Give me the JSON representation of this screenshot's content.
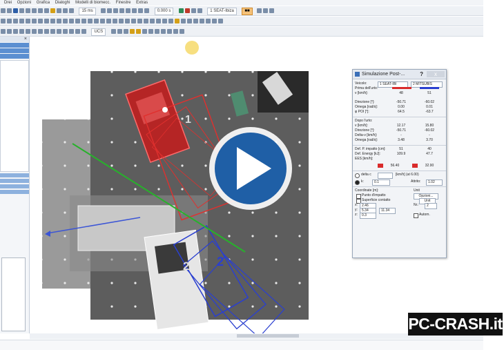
{
  "menubar": {
    "items": [
      "Drei",
      "Opzioni",
      "Grafica",
      "Dialoghi",
      "Modelli di biomecc.",
      "Finestre",
      "Extras"
    ]
  },
  "toolbar": {
    "zoom_select": "15 ms",
    "time_value": "0.000 s",
    "seat_select": "1  SEAT-Ibiza",
    "snap_select": "UCS"
  },
  "dialog": {
    "title": "Simulazione Post-...",
    "help_label": "?",
    "close_label": "x",
    "vehicle_label": "Veicolo:",
    "vehicle1": "1  SEAT-IBI",
    "vehicle2": "2  MITSUBIS",
    "before_label": "Prima dell'urto:",
    "v_label": "v [km/h]:",
    "v_before": [
      "48",
      "51"
    ],
    "direction_label": "Direzione [°]:",
    "direction_before": [
      "-50.71",
      "-60.02"
    ],
    "omega_label": "Omega [rad/s]:",
    "omega_before": [
      "0.00",
      "0.01"
    ],
    "phi_label": "φ POI [°]:",
    "phi_before": [
      "64.5",
      "-63.7"
    ],
    "after_label": "Dopo l'urto:",
    "v_after": [
      "12.17",
      "15.80"
    ],
    "direction_after": [
      "-50.71",
      "-60.02"
    ],
    "deltav_label": "Delta-v [km/h]:",
    "deltav": [
      "-",
      "-"
    ],
    "omega_after": [
      "3.48",
      "3.70"
    ],
    "defl_label": "Def. P. impatto [cm]:",
    "defl": [
      "51",
      "40"
    ],
    "energy_label": "Def. Energy [kJ]:",
    "energy": [
      "109.9",
      "47.7"
    ],
    "ees_label": "EES [km/h]:",
    "ees": [
      "56.40",
      "32.90"
    ],
    "delta_c_label": "delta c",
    "kmh_note": "[km/h] (at 6.00)",
    "k_label": "k:",
    "k_value": "0.1",
    "friction_label": "Attrito:",
    "friction_value": "1.02",
    "coords_label": "Coordinate [m]:",
    "impact_point_label": "Punto d'impatto",
    "contact_surface_label": "Superficie contatto",
    "x_label": "x:",
    "x_value": "2.46",
    "y_label": "y:",
    "y_value": "5.34",
    "z_label": "z:",
    "z_value": "0.3",
    "phi_val": "11.34",
    "units_label": "Unit",
    "options_button": "Opzioni...",
    "unit_button": "Unit",
    "nr_label": "Nr.:",
    "nr_value": "2",
    "auto_label": "Autom."
  },
  "scene": {
    "vehicle1_label": "1",
    "vehicle2_label": "2",
    "label_2b": "2"
  },
  "logo": {
    "text": "PC-CRASH.it"
  },
  "colors": {
    "vehicle1": "#d92b2b",
    "vehicle2": "#2a3fd0",
    "line": "#27b22b",
    "play": "#1f5fa6"
  }
}
